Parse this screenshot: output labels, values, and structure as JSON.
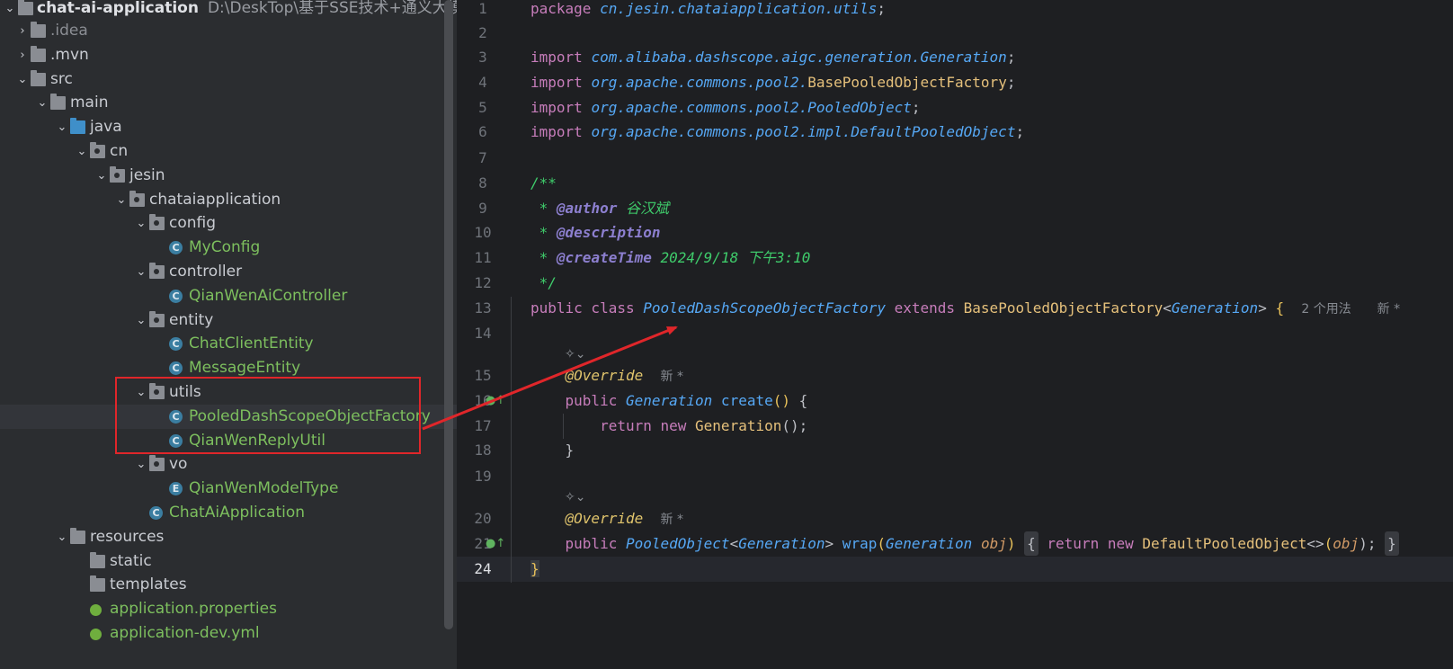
{
  "project": {
    "root_name": "chat-ai-application",
    "root_path": "D:\\DeskTop\\基于SSE技术+通义大模型服务的",
    "nodes": [
      {
        "label": ".idea",
        "kind": "folder",
        "muted": true
      },
      {
        "label": ".mvn",
        "kind": "folder"
      },
      {
        "label": "src",
        "kind": "folder"
      },
      {
        "label": "main",
        "kind": "folder"
      },
      {
        "label": "java",
        "kind": "folder-blue"
      },
      {
        "label": "cn",
        "kind": "package"
      },
      {
        "label": "jesin",
        "kind": "package"
      },
      {
        "label": "chataiapplication",
        "kind": "package"
      },
      {
        "label": "config",
        "kind": "package"
      },
      {
        "label": "MyConfig",
        "kind": "class"
      },
      {
        "label": "controller",
        "kind": "package"
      },
      {
        "label": "QianWenAiController",
        "kind": "class"
      },
      {
        "label": "entity",
        "kind": "package"
      },
      {
        "label": "ChatClientEntity",
        "kind": "class"
      },
      {
        "label": "MessageEntity",
        "kind": "class"
      },
      {
        "label": "utils",
        "kind": "package"
      },
      {
        "label": "PooledDashScopeObjectFactory",
        "kind": "class",
        "selected": true
      },
      {
        "label": "QianWenReplyUtil",
        "kind": "class"
      },
      {
        "label": "vo",
        "kind": "package"
      },
      {
        "label": "QianWenModelType",
        "kind": "enum"
      },
      {
        "label": "ChatAiApplication",
        "kind": "app-class"
      },
      {
        "label": "resources",
        "kind": "resources"
      },
      {
        "label": "static",
        "kind": "folder"
      },
      {
        "label": "templates",
        "kind": "folder"
      },
      {
        "label": "application.properties",
        "kind": "config-file"
      },
      {
        "label": "application-dev.yml",
        "kind": "config-file"
      }
    ]
  },
  "editor": {
    "line_numbers": [
      "1",
      "2",
      "3",
      "4",
      "5",
      "6",
      "7",
      "8",
      "9",
      "10",
      "11",
      "12",
      "13",
      "14",
      "15",
      "16",
      "17",
      "18",
      "19",
      "20",
      "21",
      "24"
    ],
    "code": {
      "l1_kw": "package",
      "l1_pkg": "cn.jesin.chataiapplication.utils",
      "l1_end": ";",
      "l3_kw": "import",
      "l3_pkg": "com.alibaba.dashscope.aigc.generation.",
      "l3_cls": "Generation",
      "l3_end": ";",
      "l4_kw": "import",
      "l4_pkg": "org.apache.commons.pool2.",
      "l4_cls": "BasePooledObjectFactory",
      "l4_end": ";",
      "l5_kw": "import",
      "l5_pkg": "org.apache.commons.pool2.",
      "l5_cls": "PooledObject",
      "l5_end": ";",
      "l6_kw": "import",
      "l6_pkg": "org.apache.commons.pool2.impl.",
      "l6_cls": "DefaultPooledObject",
      "l6_end": ";",
      "l8": "/**",
      "l9_star": " * ",
      "l9_tag": "@author",
      "l9_val": " 谷汉斌",
      "l10_star": " * ",
      "l10_tag": "@description",
      "l11_star": " * ",
      "l11_tag": "@createTime",
      "l11_val": " 2024/9/18 下午3:10",
      "l12": " */",
      "l13_mod": "public class ",
      "l13_name": "PooledDashScopeObjectFactory",
      "l13_ext": " extends ",
      "l13_base": "BasePooledObjectFactory",
      "l13_lt": "<",
      "l13_gen": "Generation",
      "l13_gt": ">",
      "l13_brace": " {",
      "l13_hint": "2 个用法",
      "l13_new": "新 *",
      "l15_ann": "@Override",
      "l15_new": "新 *",
      "l16_mod": "public ",
      "l16_type": "Generation",
      "l16_fn": " create",
      "l16_par": "()",
      "l16_brace": " {",
      "l17_kw": "return new ",
      "l17_type": "Generation",
      "l17_rest": "();",
      "l18": "}",
      "l20_ann": "@Override",
      "l20_new": "新 *",
      "l21_mod": "public ",
      "l21_type": "PooledObject",
      "l21_lt": "<",
      "l21_gen": "Generation",
      "l21_gt": ">",
      "l21_fn": " wrap",
      "l21_open": "(",
      "l21_ptype": "Generation",
      "l21_pname": " obj",
      "l21_close": ")",
      "l21_fold_open": "{",
      "l21_ret": " return new ",
      "l21_dpo": "DefaultPooledObject",
      "l21_diam": "<>",
      "l21_arg_open": "(",
      "l21_arg": "obj",
      "l21_arg_close": ");",
      "l21_fold_close": "}",
      "l24": "}"
    }
  },
  "colors": {
    "highlight": "#e0262a",
    "class_green": "#7dbf5e",
    "keyword": "#cf8e6d"
  }
}
